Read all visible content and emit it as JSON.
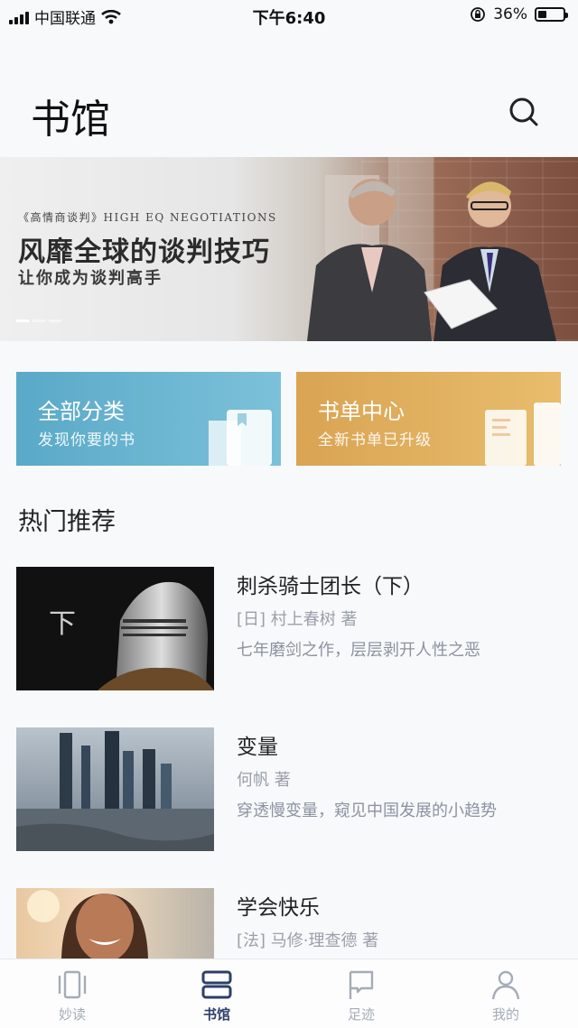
{
  "status_bar": {
    "carrier": "中国联通",
    "time": "下午6:40",
    "battery": "36%",
    "battery_level": 0.36
  },
  "header": {
    "title": "书馆"
  },
  "banner": {
    "kicker": "《高情商谈判》HIGH EQ NEGOTIATIONS",
    "headline": "风靡全球的谈判技巧",
    "subhead": "让你成为谈判高手"
  },
  "cards": [
    {
      "title": "全部分类",
      "subtitle": "发现你要的书",
      "color": "#5aa9c8"
    },
    {
      "title": "书单中心",
      "subtitle": "全新书单已升级",
      "color": "#d9a454"
    }
  ],
  "section": {
    "title": "热门推荐"
  },
  "books": [
    {
      "title": "刺杀骑士团长（下）",
      "author": "[日] 村上春树 著",
      "desc": "七年磨剑之作，层层剥开人性之恶",
      "cover_text": "下"
    },
    {
      "title": "变量",
      "author": "何帆 著",
      "desc": "穿透慢变量，窥见中国发展的小趋势"
    },
    {
      "title": "学会快乐",
      "author": "[法] 马修·理查德 著",
      "desc": ""
    }
  ],
  "tabs": [
    {
      "label": "妙读",
      "icon": "cards-icon",
      "active": false
    },
    {
      "label": "书馆",
      "icon": "library-icon",
      "active": true
    },
    {
      "label": "足迹",
      "icon": "flag-icon",
      "active": false
    },
    {
      "label": "我的",
      "icon": "person-icon",
      "active": false
    }
  ],
  "colors": {
    "active_tab": "#2d3f68",
    "inactive_tab": "#a5acb6"
  }
}
